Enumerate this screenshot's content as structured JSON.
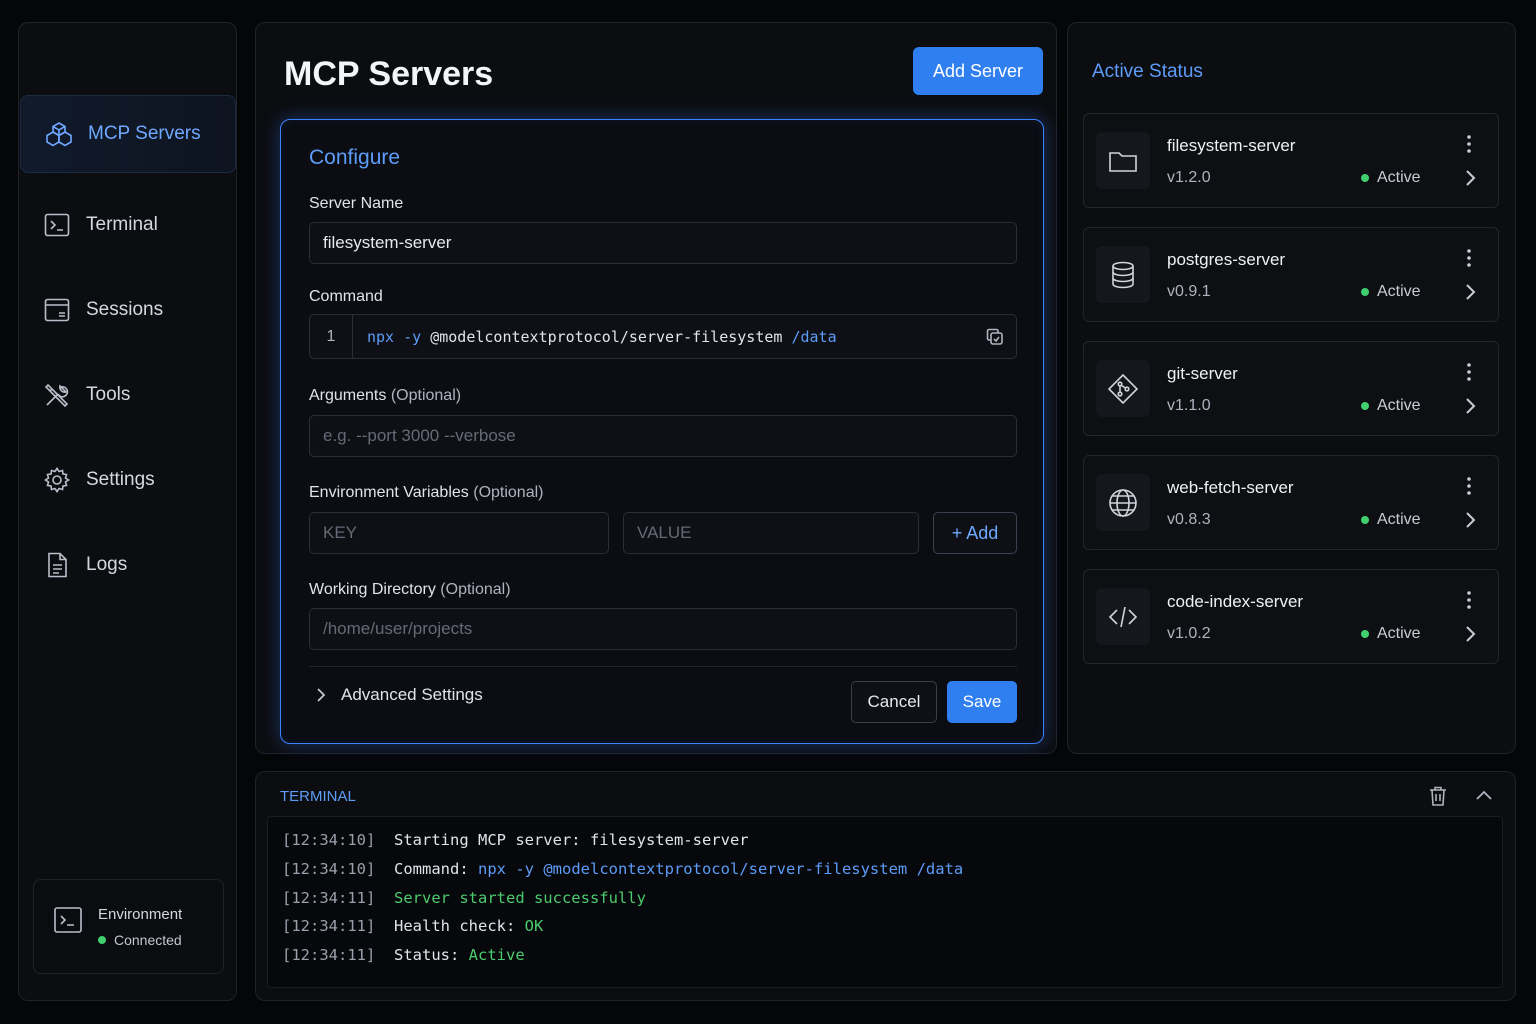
{
  "sidebar": {
    "items": [
      {
        "label": "MCP Servers",
        "icon": "cube-cluster-icon",
        "active": true
      },
      {
        "label": "Terminal",
        "icon": "terminal-icon"
      },
      {
        "label": "Sessions",
        "icon": "sessions-icon"
      },
      {
        "label": "Tools",
        "icon": "tools-icon"
      },
      {
        "label": "Settings",
        "icon": "gear-icon"
      },
      {
        "label": "Logs",
        "icon": "document-icon"
      }
    ],
    "environment": {
      "label": "Environment",
      "status": "Connected",
      "icon": "terminal-icon"
    }
  },
  "main": {
    "title": "MCP Servers",
    "add_server_label": "Add Server",
    "configure": {
      "title": "Configure",
      "server_name_label": "Server Name",
      "server_name_value": "filesystem-server",
      "command_label": "Command",
      "command_line_number": "1",
      "command_parts": {
        "bin": "npx",
        "flag": "-y",
        "package": "@modelcontextprotocol/server-filesystem",
        "arg": "/data"
      },
      "arguments_label": "Arguments",
      "arguments_optional": "(Optional)",
      "arguments_placeholder": "e.g. --port 3000 --verbose",
      "env_label": "Environment Variables",
      "env_optional": "(Optional)",
      "env_key_placeholder": "KEY",
      "env_value_placeholder": "VALUE",
      "env_add_label": "+ Add",
      "workdir_label": "Working Directory",
      "workdir_optional": "(Optional)",
      "workdir_placeholder": "/home/user/projects",
      "advanced_label": "Advanced Settings",
      "cancel_label": "Cancel",
      "save_label": "Save"
    }
  },
  "status_panel": {
    "title": "Active Status",
    "servers": [
      {
        "name": "filesystem-server",
        "version": "v1.2.0",
        "status": "Active",
        "icon": "folder-icon"
      },
      {
        "name": "postgres-server",
        "version": "v0.9.1",
        "status": "Active",
        "icon": "database-icon"
      },
      {
        "name": "git-server",
        "version": "v1.1.0",
        "status": "Active",
        "icon": "git-icon"
      },
      {
        "name": "web-fetch-server",
        "version": "v0.8.3",
        "status": "Active",
        "icon": "globe-icon"
      },
      {
        "name": "code-index-server",
        "version": "v1.0.2",
        "status": "Active",
        "icon": "code-icon"
      }
    ],
    "status_color": "#3fcf6e"
  },
  "terminal": {
    "title": "TERMINAL",
    "lines": [
      {
        "ts": "[12:34:10]",
        "text": "Starting MCP server: filesystem-server"
      },
      {
        "ts": "[12:34:10]",
        "label": "Command:",
        "cmd": "npx -y @modelcontextprotocol/server-filesystem /data"
      },
      {
        "ts": "[12:34:11]",
        "success": "Server started successfully"
      },
      {
        "ts": "[12:34:11]",
        "label": "Health check:",
        "ok": "OK"
      },
      {
        "ts": "[12:34:11]",
        "label": "Status:",
        "active": "Active"
      }
    ]
  },
  "colors": {
    "accent": "#2f7ff0",
    "accent_text": "#5d9cf8",
    "success": "#4ccb6e"
  }
}
